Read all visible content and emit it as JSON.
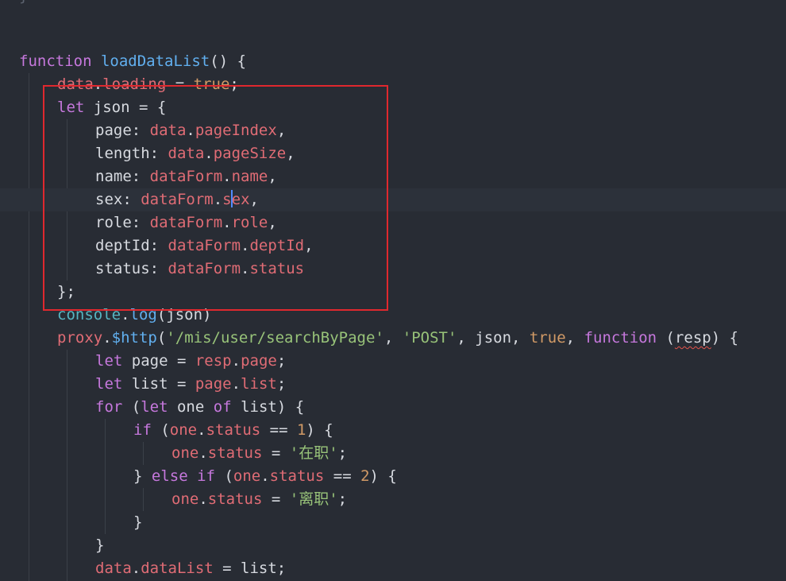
{
  "editor": {
    "top_fragment": "}",
    "lines": [
      {
        "segments": [
          [
            "kw",
            "function"
          ],
          [
            "pl",
            " "
          ],
          [
            "fn",
            "loadDataList"
          ],
          [
            "pl",
            "() {"
          ]
        ]
      },
      {
        "segments": [
          [
            "prop",
            "data"
          ],
          [
            "pl",
            "."
          ],
          [
            "prop",
            "loading"
          ],
          [
            "pl",
            " = "
          ],
          [
            "bool",
            "true"
          ],
          [
            "pl",
            ";"
          ]
        ]
      },
      {
        "segments": [
          [
            "kw",
            "let"
          ],
          [
            "pl",
            " json = {"
          ]
        ]
      },
      {
        "segments": [
          [
            "pl",
            "page: "
          ],
          [
            "prop",
            "data"
          ],
          [
            "pl",
            "."
          ],
          [
            "prop",
            "pageIndex"
          ],
          [
            "pl",
            ","
          ]
        ]
      },
      {
        "segments": [
          [
            "pl",
            "length: "
          ],
          [
            "prop",
            "data"
          ],
          [
            "pl",
            "."
          ],
          [
            "prop",
            "pageSize"
          ],
          [
            "pl",
            ","
          ]
        ]
      },
      {
        "segments": [
          [
            "pl",
            "name: "
          ],
          [
            "prop",
            "dataForm"
          ],
          [
            "pl",
            "."
          ],
          [
            "prop",
            "name"
          ],
          [
            "pl",
            ","
          ]
        ]
      },
      {
        "segments": [
          [
            "pl",
            "sex: "
          ],
          [
            "prop",
            "dataForm"
          ],
          [
            "pl",
            "."
          ],
          [
            "prop",
            "s"
          ],
          [
            "caret",
            ""
          ],
          [
            "prop",
            "ex"
          ],
          [
            "pl",
            ","
          ]
        ]
      },
      {
        "segments": [
          [
            "pl",
            "role: "
          ],
          [
            "prop",
            "dataForm"
          ],
          [
            "pl",
            "."
          ],
          [
            "prop",
            "role"
          ],
          [
            "pl",
            ","
          ]
        ]
      },
      {
        "segments": [
          [
            "pl",
            "deptId: "
          ],
          [
            "prop",
            "dataForm"
          ],
          [
            "pl",
            "."
          ],
          [
            "prop",
            "deptId"
          ],
          [
            "pl",
            ","
          ]
        ]
      },
      {
        "segments": [
          [
            "pl",
            "status: "
          ],
          [
            "prop",
            "dataForm"
          ],
          [
            "pl",
            "."
          ],
          [
            "prop",
            "status"
          ]
        ]
      },
      {
        "segments": [
          [
            "pl",
            "};"
          ]
        ]
      },
      {
        "segments": [
          [
            "obj",
            "console"
          ],
          [
            "pl",
            "."
          ],
          [
            "fn",
            "log"
          ],
          [
            "pl",
            "(json)"
          ]
        ]
      },
      {
        "segments": [
          [
            "prop",
            "proxy"
          ],
          [
            "pl",
            "."
          ],
          [
            "fn",
            "$http"
          ],
          [
            "pl",
            "("
          ],
          [
            "str",
            "'/mis/user/searchByPage'"
          ],
          [
            "pl",
            ", "
          ],
          [
            "str",
            "'POST'"
          ],
          [
            "pl",
            ", json, "
          ],
          [
            "bool",
            "true"
          ],
          [
            "pl",
            ", "
          ],
          [
            "kw",
            "function"
          ],
          [
            "pl",
            " ("
          ],
          [
            "squiggle",
            "resp"
          ],
          [
            "pl",
            ") {"
          ]
        ]
      },
      {
        "segments": [
          [
            "kw",
            "let"
          ],
          [
            "pl",
            " page = "
          ],
          [
            "prop",
            "resp"
          ],
          [
            "pl",
            "."
          ],
          [
            "prop",
            "page"
          ],
          [
            "pl",
            ";"
          ]
        ]
      },
      {
        "segments": [
          [
            "kw",
            "let"
          ],
          [
            "pl",
            " list = "
          ],
          [
            "prop",
            "page"
          ],
          [
            "pl",
            "."
          ],
          [
            "prop",
            "list"
          ],
          [
            "pl",
            ";"
          ]
        ]
      },
      {
        "segments": [
          [
            "kw",
            "for"
          ],
          [
            "pl",
            " ("
          ],
          [
            "kw",
            "let"
          ],
          [
            "pl",
            " one "
          ],
          [
            "kw",
            "of"
          ],
          [
            "pl",
            " list) {"
          ]
        ]
      },
      {
        "segments": [
          [
            "kw",
            "if"
          ],
          [
            "pl",
            " ("
          ],
          [
            "prop",
            "one"
          ],
          [
            "pl",
            "."
          ],
          [
            "prop",
            "status"
          ],
          [
            "pl",
            " == "
          ],
          [
            "num",
            "1"
          ],
          [
            "pl",
            ") {"
          ]
        ]
      },
      {
        "segments": [
          [
            "prop",
            "one"
          ],
          [
            "pl",
            "."
          ],
          [
            "prop",
            "status"
          ],
          [
            "pl",
            " = "
          ],
          [
            "str",
            "'在职'"
          ],
          [
            "pl",
            ";"
          ]
        ]
      },
      {
        "segments": [
          [
            "pl",
            "} "
          ],
          [
            "kw",
            "else"
          ],
          [
            "pl",
            " "
          ],
          [
            "kw",
            "if"
          ],
          [
            "pl",
            " ("
          ],
          [
            "prop",
            "one"
          ],
          [
            "pl",
            "."
          ],
          [
            "prop",
            "status"
          ],
          [
            "pl",
            " == "
          ],
          [
            "num",
            "2"
          ],
          [
            "pl",
            ") {"
          ]
        ]
      },
      {
        "segments": [
          [
            "prop",
            "one"
          ],
          [
            "pl",
            "."
          ],
          [
            "prop",
            "status"
          ],
          [
            "pl",
            " = "
          ],
          [
            "str",
            "'离职'"
          ],
          [
            "pl",
            ";"
          ]
        ]
      },
      {
        "segments": [
          [
            "pl",
            "}"
          ]
        ]
      },
      {
        "segments": [
          [
            "pl",
            "}"
          ]
        ]
      },
      {
        "segments": [
          [
            "prop",
            "data"
          ],
          [
            "pl",
            "."
          ],
          [
            "prop",
            "dataList"
          ],
          [
            "pl",
            " = list;"
          ]
        ]
      }
    ]
  },
  "colors": {
    "background": "#282c34",
    "keyword": "#c678dd",
    "function": "#61afef",
    "property": "#e06c75",
    "string": "#98c379",
    "number": "#d19a66",
    "highlight_box": "#e0282e"
  }
}
